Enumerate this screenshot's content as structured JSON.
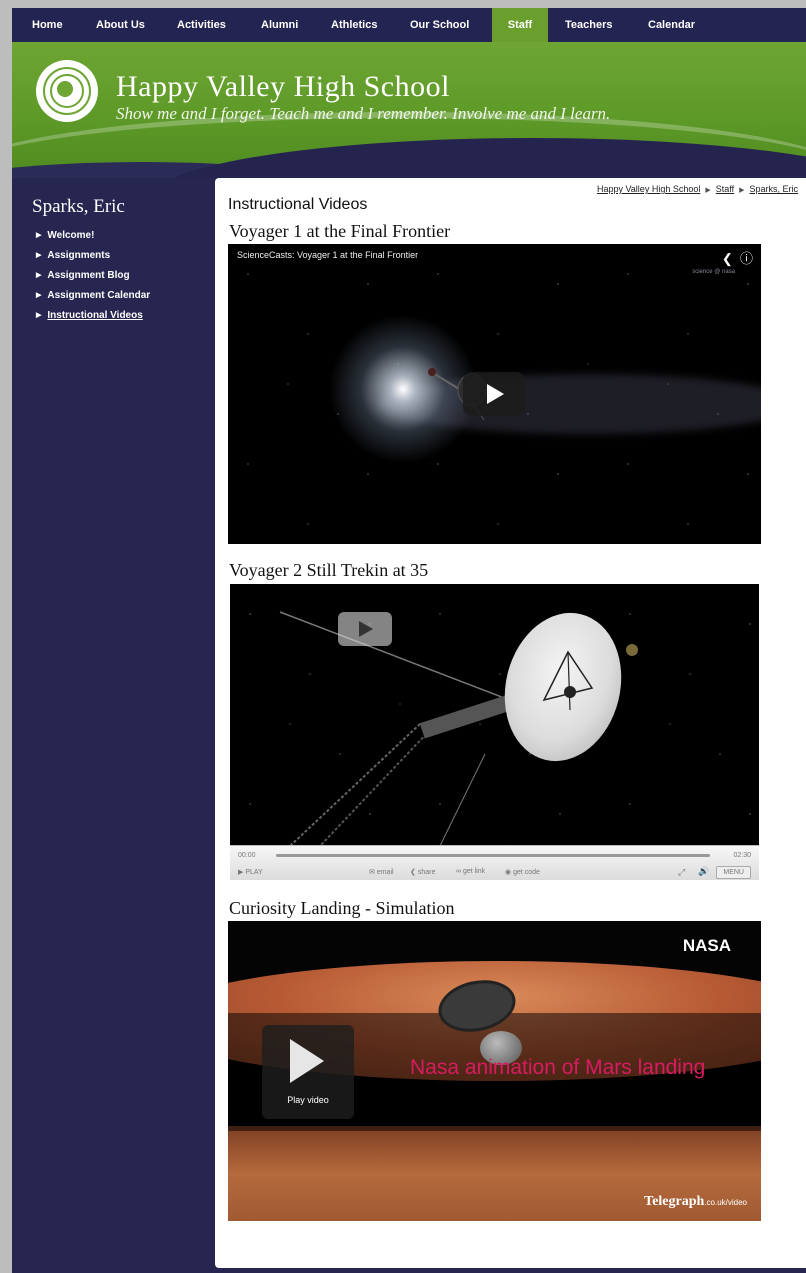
{
  "nav": {
    "items": [
      "Home",
      "About Us",
      "Activities",
      "Alumni",
      "Athletics",
      "Our School",
      "Staff",
      "Teachers",
      "Calendar"
    ],
    "active": "Staff"
  },
  "header": {
    "school_name": "Happy Valley High School",
    "tagline": "Show me and I forget. Teach me and I remember. Involve me and I learn."
  },
  "sidebar": {
    "title": "Sparks, Eric",
    "items": [
      "Welcome!",
      "Assignments",
      "Assignment Blog",
      "Assignment Calendar",
      "Instructional Videos"
    ],
    "current": "Instructional Videos"
  },
  "breadcrumb": [
    "Happy Valley High School",
    "Staff",
    "Sparks, Eric"
  ],
  "page_title": "Instructional Videos",
  "videos": [
    {
      "title": "Voyager 1 at the Final Frontier",
      "player_title": "ScienceCasts: Voyager 1 at the Final Frontier",
      "watermark": "science @ nasa"
    },
    {
      "title": "Voyager 2 Still Trekin at 35",
      "time_current": "00:00",
      "time_total": "02:30",
      "play_label": "PLAY",
      "email_label": "email",
      "share_label": "share",
      "getlink_label": "get link",
      "getcode_label": "get code",
      "menu_label": "MENU"
    },
    {
      "title": "Curiosity Landing - Simulation",
      "nasa_label": "NASA",
      "overlay_text": "Nasa animation of Mars landing",
      "play_label": "Play video",
      "brand": "Telegraph",
      "brand_domain": ".co.uk/video"
    }
  ],
  "colors": {
    "nav_bg": "#242452",
    "nav_active": "#6a9f2e",
    "header_green": "#6ea533",
    "sidebar_bg": "#262651",
    "overlay_pink": "#d81b60"
  }
}
